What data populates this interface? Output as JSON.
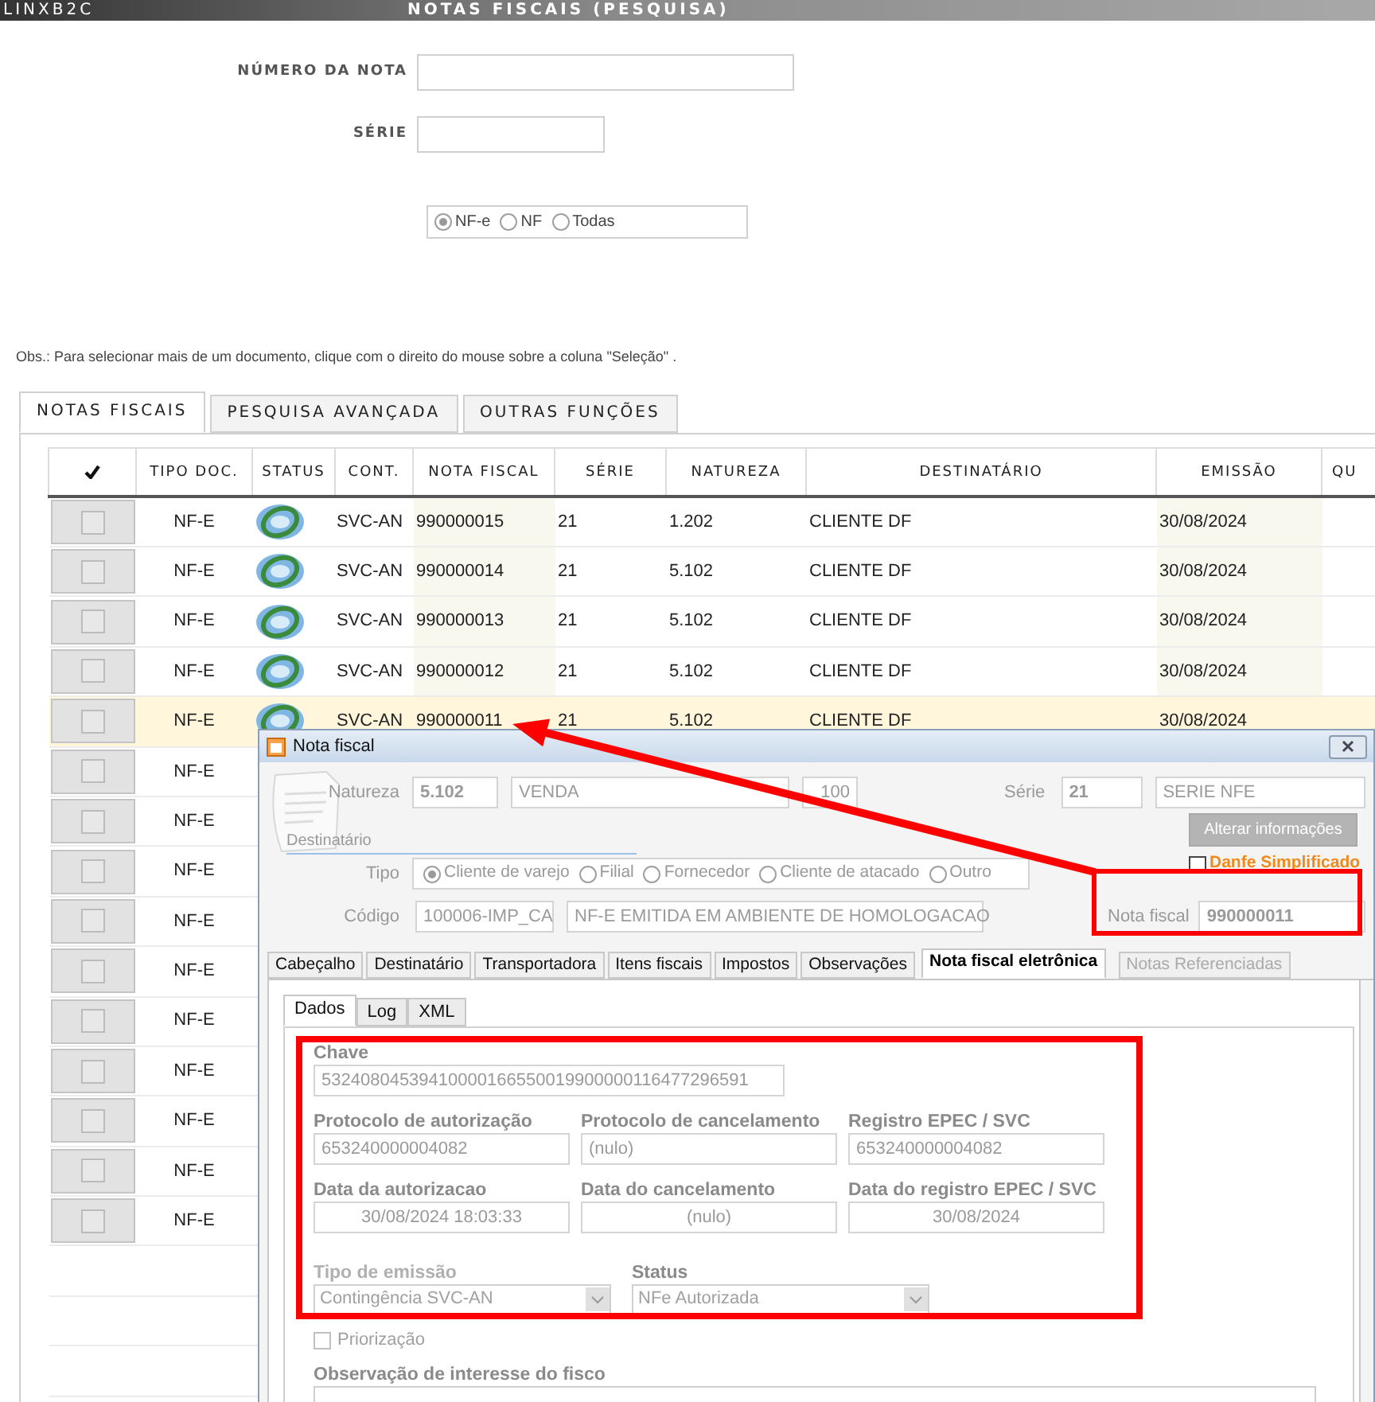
{
  "header": {
    "app": "LINXB2C",
    "title": "NOTAS FISCAIS (PESQUISA)"
  },
  "search_form": {
    "fields": [
      {
        "label": "NÚMERO DA NOTA"
      },
      {
        "label": "SÉRIE"
      }
    ],
    "doc_type": [
      {
        "label": "NF-e",
        "selected": true
      },
      {
        "label": "NF",
        "selected": false
      },
      {
        "label": "Todas",
        "selected": false
      }
    ]
  },
  "note": "Obs.: Para selecionar mais de um documento, clique com o direito do mouse sobre a coluna \"Seleção\" .",
  "tabs": [
    {
      "label": "NOTAS FISCAIS",
      "selected": true
    },
    {
      "label": "PESQUISA AVANÇADA",
      "selected": false
    },
    {
      "label": "OUTRAS FUNÇÕES",
      "selected": false
    }
  ],
  "table": {
    "columns": [
      "TIPO DOC.",
      "STATUS",
      "CONT.",
      "NOTA FISCAL",
      "SÉRIE",
      "NATUREZA",
      "DESTINATÁRIO",
      "EMISSÃO",
      "QU"
    ],
    "rows": [
      {
        "selected": false,
        "checked": false,
        "tipo": "NF-E",
        "cont": "SVC-AN",
        "nota": "990000015",
        "serie": "21",
        "natureza": "1.202",
        "destinatario": "CLIENTE DF",
        "emissao": "30/08/2024"
      },
      {
        "selected": false,
        "checked": false,
        "tipo": "NF-E",
        "cont": "SVC-AN",
        "nota": "990000014",
        "serie": "21",
        "natureza": "5.102",
        "destinatario": "CLIENTE DF",
        "emissao": "30/08/2024"
      },
      {
        "selected": false,
        "checked": false,
        "tipo": "NF-E",
        "cont": "SVC-AN",
        "nota": "990000013",
        "serie": "21",
        "natureza": "5.102",
        "destinatario": "CLIENTE DF",
        "emissao": "30/08/2024"
      },
      {
        "selected": false,
        "checked": false,
        "tipo": "NF-E",
        "cont": "SVC-AN",
        "nota": "990000012",
        "serie": "21",
        "natureza": "5.102",
        "destinatario": "CLIENTE DF",
        "emissao": "30/08/2024"
      },
      {
        "selected": true,
        "checked": false,
        "tipo": "NF-E",
        "cont": "SVC-AN",
        "nota": "990000011",
        "serie": "21",
        "natureza": "5.102",
        "destinatario": "CLIENTE DF",
        "emissao": "30/08/2024"
      },
      {
        "selected": false,
        "checked": false,
        "tipo": "NF-E"
      },
      {
        "selected": false,
        "checked": false,
        "tipo": "NF-E"
      },
      {
        "selected": false,
        "checked": false,
        "tipo": "NF-E"
      },
      {
        "selected": false,
        "checked": false,
        "tipo": "NF-E"
      },
      {
        "selected": false,
        "checked": false,
        "tipo": "NF-E"
      },
      {
        "selected": false,
        "checked": false,
        "tipo": "NF-E"
      },
      {
        "selected": false,
        "checked": false,
        "tipo": "NF-E"
      },
      {
        "selected": false,
        "checked": false,
        "tipo": "NF-E"
      },
      {
        "selected": false,
        "checked": false,
        "tipo": "NF-E"
      },
      {
        "selected": false,
        "checked": false,
        "tipo": "NF-E"
      }
    ]
  },
  "dialog": {
    "title": "Nota fiscal",
    "natureza": {
      "label": "Natureza",
      "code": "5.102",
      "description": "VENDA",
      "number": "100"
    },
    "serie": {
      "label": "Série",
      "code": "21",
      "name": "SERIE NFE"
    },
    "destinatario_label": "Destinatário",
    "alter_button": {
      "label": "Alterar informações",
      "disabled": true
    },
    "tipo": {
      "label": "Tipo",
      "options": [
        {
          "label": "Cliente de varejo",
          "selected": true
        },
        {
          "label": "Filial",
          "selected": false
        },
        {
          "label": "Fornecedor",
          "selected": false
        },
        {
          "label": "Cliente de atacado",
          "selected": false
        },
        {
          "label": "Outro",
          "selected": false
        }
      ]
    },
    "danfe": {
      "label": "Danfe Simplificado",
      "checked": false
    },
    "codigo": {
      "label": "Código",
      "code": "100006-IMP_CA",
      "description": "NF-E EMITIDA EM AMBIENTE DE HOMOLOGACAO"
    },
    "nota_fiscal": {
      "label": "Nota fiscal",
      "value": "990000011"
    },
    "tabs": [
      {
        "label": "Cabeçalho",
        "selected": false,
        "disabled": false
      },
      {
        "label": "Destinatário",
        "selected": false,
        "disabled": false
      },
      {
        "label": "Transportadora",
        "selected": false,
        "disabled": false
      },
      {
        "label": "Itens fiscais",
        "selected": false,
        "disabled": false
      },
      {
        "label": "Impostos",
        "selected": false,
        "disabled": false
      },
      {
        "label": "Observações",
        "selected": false,
        "disabled": false
      },
      {
        "label": "Nota fiscal eletrônica",
        "selected": true,
        "disabled": false
      },
      {
        "label": "Notas Referenciadas",
        "selected": false,
        "disabled": true
      }
    ],
    "subtabs": [
      {
        "label": "Dados",
        "selected": true
      },
      {
        "label": "Log",
        "selected": false
      },
      {
        "label": "XML",
        "selected": false
      }
    ],
    "nfe": {
      "chave": {
        "label": "Chave",
        "value": "53240804539410000166550019900000116477296591"
      },
      "rows": [
        [
          {
            "label": "Protocolo de autorização",
            "value": "653240000004082",
            "kind": "text"
          },
          {
            "label": "Protocolo de cancelamento",
            "value": "(nulo)",
            "kind": "text"
          },
          {
            "label": "Registro EPEC / SVC",
            "value": "653240000004082",
            "kind": "text"
          }
        ],
        [
          {
            "label": "Data da autorizacao",
            "value": "30/08/2024 18:03:33",
            "kind": "date"
          },
          {
            "label": "Data do cancelamento",
            "value": "(nulo)",
            "kind": "date"
          },
          {
            "label": "Data do registro EPEC / SVC",
            "value": "30/08/2024",
            "kind": "date"
          }
        ]
      ],
      "selects": [
        {
          "label": "Tipo de emissão",
          "value": "Contingência SVC-AN",
          "disabled": true
        },
        {
          "label": "Status",
          "value": "NFe Autorizada",
          "disabled": false
        }
      ],
      "priorizacao": {
        "label": "Priorização",
        "checked": false
      },
      "observacao": {
        "label": "Observação de interesse do fisco"
      }
    }
  }
}
